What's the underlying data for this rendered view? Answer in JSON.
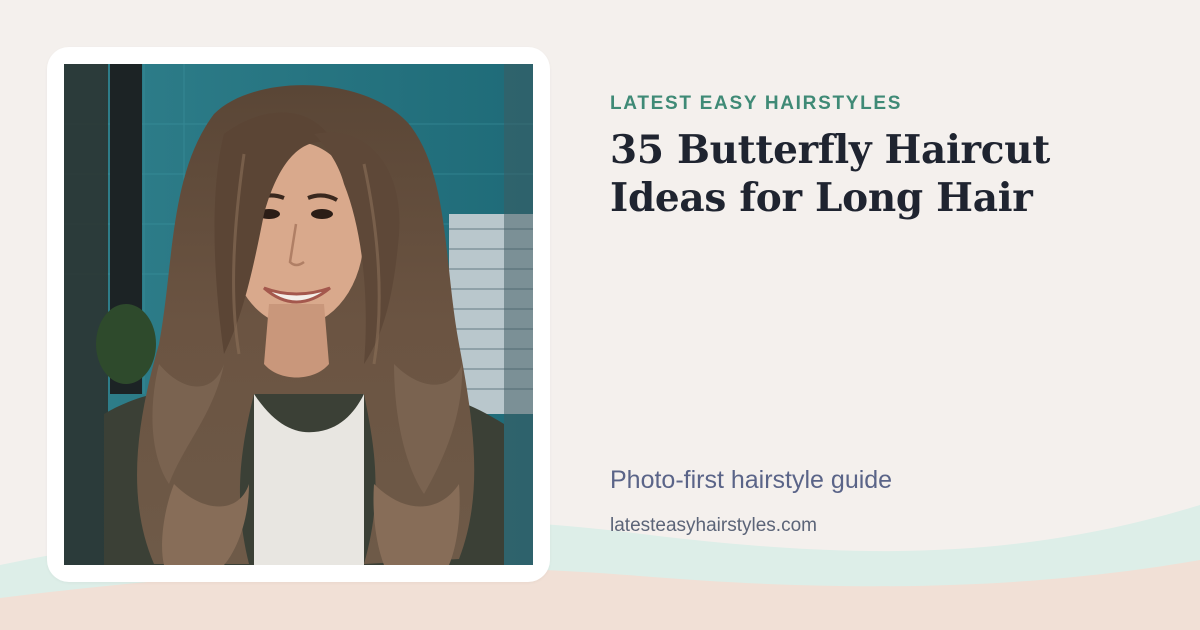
{
  "card": {
    "eyebrow": "LATEST EASY HAIRSTYLES",
    "headline": "35 Butterfly Haircut Ideas for Long Hair",
    "tagline": "Photo-first hairstyle guide",
    "site_url": "latesteasyhairstyles.com"
  },
  "photo": {
    "subject": "woman with long layered butterfly haircut, brown hair with curtain fringe, smiling"
  },
  "colors": {
    "background": "#f4f0ed",
    "accent_green": "#3f8a76",
    "headline": "#1f2430",
    "tagline": "#5a6488",
    "wave_mint": "#ddeee8",
    "wave_peach": "#f1e0d6"
  }
}
